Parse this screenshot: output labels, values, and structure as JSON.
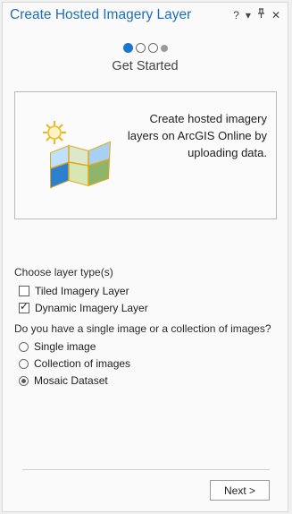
{
  "panel": {
    "title": "Create Hosted Imagery Layer",
    "controls": {
      "help": "?",
      "menu": "▾",
      "pin": "⊥",
      "close": "✕"
    }
  },
  "steps": {
    "label": "Get Started",
    "current": 1,
    "total": 4
  },
  "info": {
    "icon": "imagery-map-sun-icon",
    "text": "Create hosted imagery layers on ArcGIS Online by uploading data."
  },
  "layer_type": {
    "label": "Choose layer type(s)",
    "options": [
      {
        "label": "Tiled Imagery Layer",
        "checked": false
      },
      {
        "label": "Dynamic Imagery Layer",
        "checked": true
      }
    ]
  },
  "images": {
    "question": "Do you have a single image or a collection of images?",
    "options": [
      {
        "label": "Single image",
        "selected": false
      },
      {
        "label": "Collection of images",
        "selected": false
      },
      {
        "label": "Mosaic Dataset",
        "selected": true
      }
    ]
  },
  "footer": {
    "next_label": "Next >"
  }
}
